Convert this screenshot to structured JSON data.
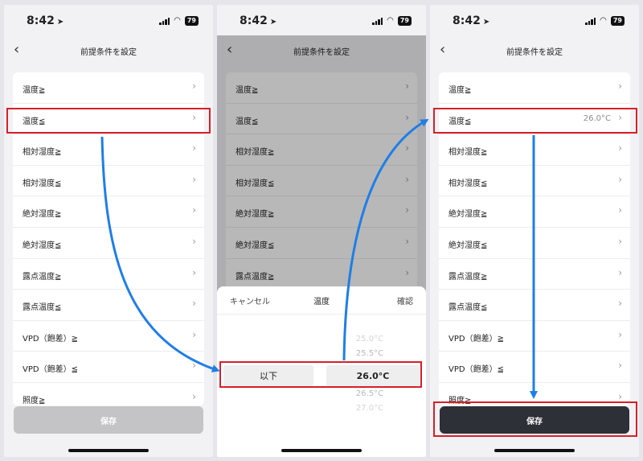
{
  "status": {
    "time": "8:42",
    "battery": "79"
  },
  "nav": {
    "title": "前提条件を設定"
  },
  "rows_labels": [
    "温度≧",
    "温度≦",
    "相対湿度≧",
    "相対湿度≦",
    "絶対湿度≧",
    "絶対湿度≦",
    "露点温度≧",
    "露点温度≦",
    "VPD（飽差）≧",
    "VPD（飽差）≦",
    "照度≧"
  ],
  "panel3": {
    "selected_value": "26.0°C"
  },
  "save_label": "保存",
  "sheet": {
    "cancel": "キャンセル",
    "title": "温度",
    "confirm": "確認",
    "mode_selected": "以下",
    "values_above": [
      "25.0°C",
      "25.5°C"
    ],
    "value_selected": "26.0°C",
    "values_below": [
      "26.5°C",
      "27.0°C"
    ]
  },
  "colors": {
    "highlight": "#d81e2a",
    "arrow": "#1f7ee6",
    "save_active": "#2e3038",
    "save_disabled": "#c4c4c6"
  }
}
